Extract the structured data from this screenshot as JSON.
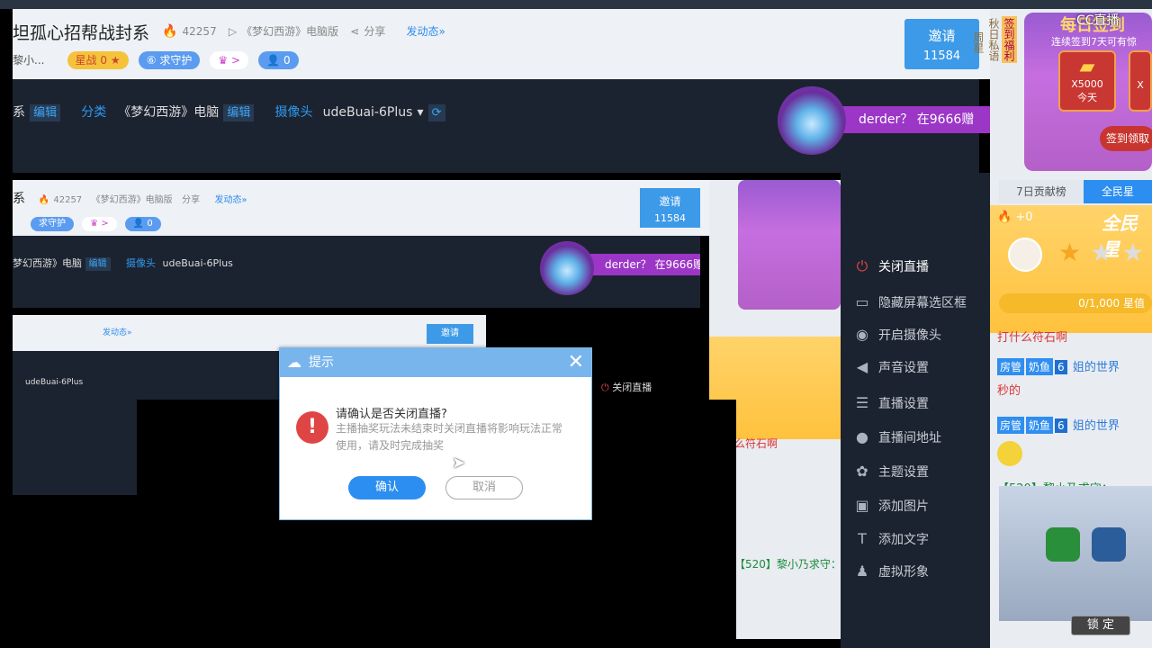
{
  "header": {
    "title": "坦孤心招帮战封系",
    "hot_count": "42257",
    "game_name": "《梦幻西游》电脑版",
    "share_label": "分享",
    "post_label": "发动态»",
    "streamer": "黎小...",
    "badges": {
      "star_label": "星战",
      "star_count": "0",
      "guard_label": "求守护",
      "fans_count": "0"
    },
    "invite": {
      "label": "邀请",
      "count": "11584"
    }
  },
  "toolbar": {
    "tag_suffix": "系",
    "edit_label": "编辑",
    "category_label": "分类",
    "category_value": "《梦幻西游》电脑",
    "camera_label": "摄像头",
    "camera_value": "udeBuai-6Plus"
  },
  "banner": {
    "text": "derder？ 在9666赠"
  },
  "right_panel": {
    "side_tabs": [
      "签到福利",
      "秋日私语",
      "周星"
    ],
    "sign_title": "每日签到",
    "sign_sub": "连续签到7天可有惊",
    "reward_amount": "X5000",
    "reward_day": "今天",
    "reward_amount_2": "X",
    "sign_button": "签到领取",
    "tab_contrib": "7日贡献榜",
    "tab_all": "全民星",
    "fan_hot": "+0",
    "fan_title": "全民星",
    "fan_progress": "0/1,000 星值",
    "chat_top": "打什么符石啊",
    "chat": [
      {
        "role": "房管",
        "fan": "奶鱼",
        "level": "6",
        "text": "姐的世界"
      },
      {
        "text": "秒的"
      },
      {
        "role": "房管",
        "fan": "奶鱼",
        "level": "6",
        "text": "姐的世界"
      }
    ],
    "gift_msg": "【520】黎小乃求守：",
    "lock_button": "锁 定"
  },
  "menu": {
    "items": [
      {
        "icon": "power-icon",
        "label": "关闭直播"
      },
      {
        "icon": "screen-icon",
        "label": "隐藏屏幕选区框"
      },
      {
        "icon": "camera-icon",
        "label": "开启摄像头"
      },
      {
        "icon": "volume-icon",
        "label": "声音设置"
      },
      {
        "icon": "settings-sliders-icon",
        "label": "直播设置"
      },
      {
        "icon": "location-icon",
        "label": "直播间地址"
      },
      {
        "icon": "palette-icon",
        "label": "主题设置"
      },
      {
        "icon": "image-icon",
        "label": "添加图片"
      },
      {
        "icon": "text-icon",
        "label": "添加文字"
      },
      {
        "icon": "avatar-icon",
        "label": "虚拟形象"
      }
    ]
  },
  "nested": {
    "title_suffix": "系",
    "hot_count": "42257",
    "game_name": "《梦幻西游》电脑版",
    "share_label": "分享",
    "post_label": "发动态»",
    "invite_label": "邀请",
    "invite_count": "11584",
    "camera_value": "udeBuai-6Plus",
    "category_value": "梦幻西游》电脑",
    "edit_label": "编辑",
    "camera_label": "摄像头",
    "banner": "derder？ 在9666赠",
    "close_live": "关闭直播",
    "chat_top": "么符石啊",
    "gift_msg": "【520】黎小乃求守：",
    "post_label_2": "发动态»",
    "invite_label_2": "邀请"
  },
  "dialog": {
    "title": "提示",
    "question": "请确认是否关闭直播?",
    "description": "主播抽奖玩法未结束时关闭直播将影响玩法正常使用，请及时完成抽奖",
    "ok_label": "确认",
    "cancel_label": "取消"
  },
  "watermark": "CC直播",
  "colors": {
    "accent_blue": "#2d8cf0",
    "dark_bg": "#1c2330",
    "purple": "#9b36c6",
    "danger_red": "#e04545"
  }
}
